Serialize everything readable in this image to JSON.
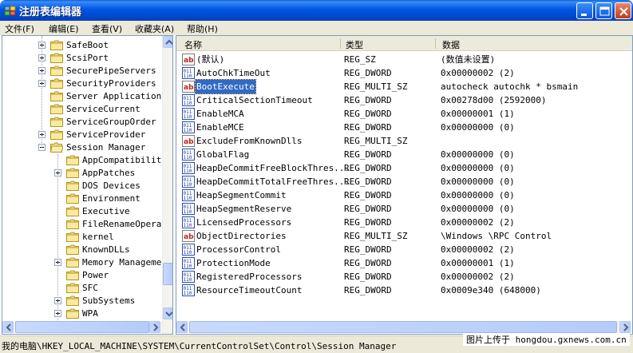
{
  "window": {
    "title": "注册表编辑器"
  },
  "menu": [
    {
      "label": "文件(F)"
    },
    {
      "label": "编辑(E)"
    },
    {
      "label": "查看(V)"
    },
    {
      "label": "收藏夹(A)"
    },
    {
      "label": "帮助(H)"
    }
  ],
  "tree": {
    "items": [
      {
        "label": "SafeBoot",
        "expandable": true
      },
      {
        "label": "ScsiPort",
        "expandable": true
      },
      {
        "label": "SecurePipeServers",
        "expandable": true
      },
      {
        "label": "SecurityProviders",
        "expandable": true
      },
      {
        "label": "Server Applications",
        "expandable": false
      },
      {
        "label": "ServiceCurrent",
        "expandable": false
      },
      {
        "label": "ServiceGroupOrder",
        "expandable": false
      },
      {
        "label": "ServiceProvider",
        "expandable": true
      },
      {
        "label": "Session Manager",
        "expanded": true
      },
      {
        "label": "AppCompatibility",
        "expandable": false,
        "child": true
      },
      {
        "label": "AppPatches",
        "expandable": true,
        "child": true
      },
      {
        "label": "DOS Devices",
        "expandable": false,
        "child": true
      },
      {
        "label": "Environment",
        "expandable": false,
        "child": true
      },
      {
        "label": "Executive",
        "expandable": false,
        "child": true
      },
      {
        "label": "FileRenameOperat",
        "expandable": false,
        "child": true
      },
      {
        "label": "kernel",
        "expandable": false,
        "child": true
      },
      {
        "label": "KnownDLLs",
        "expandable": false,
        "child": true
      },
      {
        "label": "Memory Managemen",
        "expandable": true,
        "child": true
      },
      {
        "label": "Power",
        "expandable": false,
        "child": true
      },
      {
        "label": "SFC",
        "expandable": false,
        "child": true
      },
      {
        "label": "SubSystems",
        "expandable": true,
        "child": true
      },
      {
        "label": "WPA",
        "expandable": true,
        "child": true
      }
    ]
  },
  "list": {
    "headers": {
      "name": "名称",
      "type": "类型",
      "data": "数据"
    },
    "rows": [
      {
        "name": "(默认)",
        "type": "REG_SZ",
        "data": "(数值未设置)",
        "icon": "string"
      },
      {
        "name": "AutoChkTimeOut",
        "type": "REG_DWORD",
        "data": "0x00000002 (2)",
        "icon": "binary"
      },
      {
        "name": "BootExecute",
        "type": "REG_MULTI_SZ",
        "data": "autocheck autochk *  bsmain",
        "icon": "string",
        "selected": true
      },
      {
        "name": "CriticalSectionTimeout",
        "type": "REG_DWORD",
        "data": "0x00278d00 (2592000)",
        "icon": "binary"
      },
      {
        "name": "EnableMCA",
        "type": "REG_DWORD",
        "data": "0x00000001 (1)",
        "icon": "binary"
      },
      {
        "name": "EnableMCE",
        "type": "REG_DWORD",
        "data": "0x00000000 (0)",
        "icon": "binary"
      },
      {
        "name": "ExcludeFromKnownDlls",
        "type": "REG_MULTI_SZ",
        "data": "",
        "icon": "string"
      },
      {
        "name": "GlobalFlag",
        "type": "REG_DWORD",
        "data": "0x00000000 (0)",
        "icon": "binary"
      },
      {
        "name": "HeapDeCommitFreeBlockThres...",
        "type": "REG_DWORD",
        "data": "0x00000000 (0)",
        "icon": "binary"
      },
      {
        "name": "HeapDeCommitTotalFreeThres...",
        "type": "REG_DWORD",
        "data": "0x00000000 (0)",
        "icon": "binary"
      },
      {
        "name": "HeapSegmentCommit",
        "type": "REG_DWORD",
        "data": "0x00000000 (0)",
        "icon": "binary"
      },
      {
        "name": "HeapSegmentReserve",
        "type": "REG_DWORD",
        "data": "0x00000000 (0)",
        "icon": "binary"
      },
      {
        "name": "LicensedProcessors",
        "type": "REG_DWORD",
        "data": "0x00000002 (2)",
        "icon": "binary"
      },
      {
        "name": "ObjectDirectories",
        "type": "REG_MULTI_SZ",
        "data": "\\Windows \\RPC Control",
        "icon": "string"
      },
      {
        "name": "ProcessorControl",
        "type": "REG_DWORD",
        "data": "0x00000002 (2)",
        "icon": "binary"
      },
      {
        "name": "ProtectionMode",
        "type": "REG_DWORD",
        "data": "0x00000001 (1)",
        "icon": "binary"
      },
      {
        "name": "RegisteredProcessors",
        "type": "REG_DWORD",
        "data": "0x00000002 (2)",
        "icon": "binary"
      },
      {
        "name": "ResourceTimeoutCount",
        "type": "REG_DWORD",
        "data": "0x0009e340 (648000)",
        "icon": "binary"
      }
    ]
  },
  "status": {
    "path": "我的电脑\\HKEY_LOCAL_MACHINE\\SYSTEM\\CurrentControlSet\\Control\\Session Manager",
    "watermark": "图片上传于 hongdou.gxnews.com.cn"
  }
}
